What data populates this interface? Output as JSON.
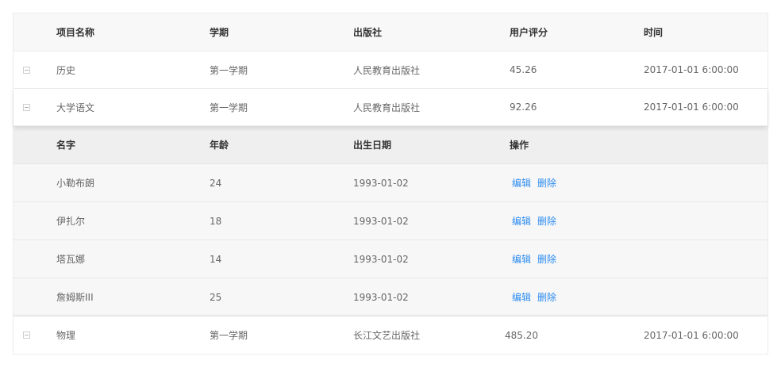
{
  "main_table": {
    "headers": [
      "项目名称",
      "学期",
      "出版社",
      "用户评分",
      "时间"
    ],
    "rows": [
      {
        "name": "历史",
        "term": "第一学期",
        "publisher": "人民教育出版社",
        "rating": "45.26",
        "time": "2017-01-01 6:00:00",
        "expanded": false
      },
      {
        "name": "大学语文",
        "term": "第一学期",
        "publisher": "人民教育出版社",
        "rating": "92.26",
        "time": "2017-01-01 6:00:00",
        "expanded": true
      },
      {
        "name": "物理",
        "term": "第一学期",
        "publisher": "长江文艺出版社",
        "rating": "485.20",
        "time": "2017-01-01 6:00:00",
        "expanded": false
      }
    ]
  },
  "sub_table": {
    "headers": [
      "名字",
      "年龄",
      "出生日期",
      "操作"
    ],
    "rows": [
      {
        "name": "小勒布朗",
        "age": "24",
        "birth": "1993-01-02"
      },
      {
        "name": "伊扎尔",
        "age": "18",
        "birth": "1993-01-02"
      },
      {
        "name": "塔瓦娜",
        "age": "14",
        "birth": "1993-01-02"
      },
      {
        "name": "詹姆斯III",
        "age": "25",
        "birth": "1993-01-02"
      }
    ],
    "actions": {
      "edit": "编辑",
      "delete": "删除"
    }
  },
  "colors": {
    "link": "#2d8cf0",
    "header_bg": "#f8f8f8",
    "sub_header_bg": "#efefef",
    "sub_row_bg": "#f7f7f7",
    "border": "#ececec"
  },
  "icons": {
    "collapsed": "collapse-toggle-icon",
    "expanded": "expand-toggle-icon"
  }
}
